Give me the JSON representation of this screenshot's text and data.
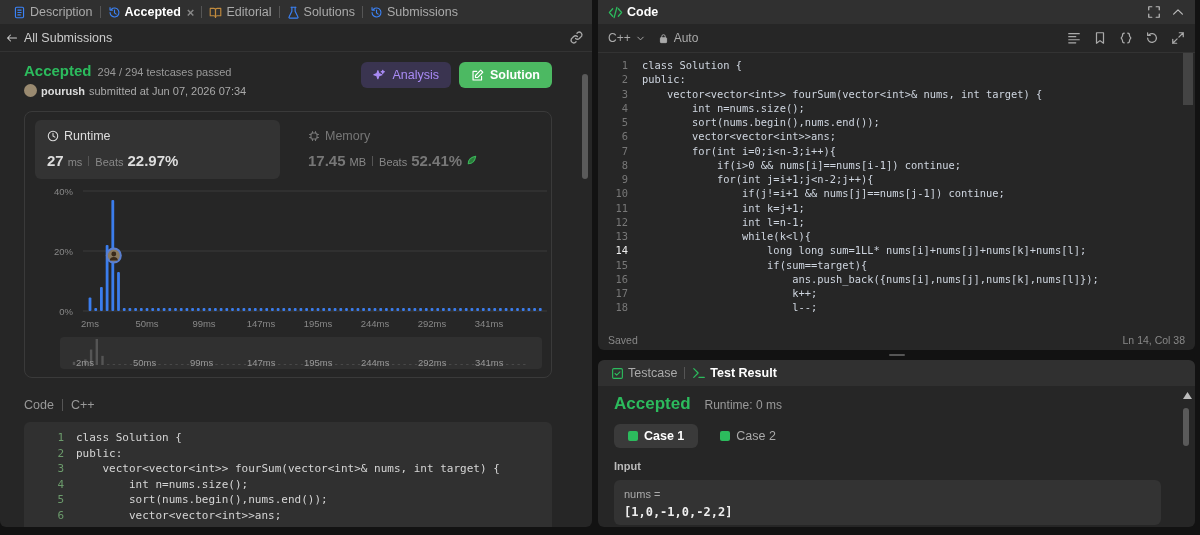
{
  "tabs": [
    {
      "label": "Description",
      "kind": "doc",
      "selected": false
    },
    {
      "label": "Accepted",
      "kind": "history",
      "selected": true,
      "close": "×"
    },
    {
      "label": "Editorial",
      "kind": "book",
      "selected": false
    },
    {
      "label": "Solutions",
      "kind": "flask",
      "selected": false
    },
    {
      "label": "Submissions",
      "kind": "history",
      "selected": false
    }
  ],
  "back_link": "All Submissions",
  "submission": {
    "status": "Accepted",
    "passed": "294 / 294 testcases passed",
    "user": "pourush",
    "submitted": "submitted at Jun 07, 2026 07:34",
    "buttons": [
      {
        "label": "Analysis",
        "kind": "analysis"
      },
      {
        "label": "Solution",
        "kind": "solution"
      }
    ]
  },
  "metrics": [
    {
      "kind": "runtime",
      "label": "Runtime",
      "value": "27",
      "unit": "ms",
      "beats_label": "Beats",
      "beats": "22.97%",
      "selected": true
    },
    {
      "kind": "memory",
      "label": "Memory",
      "value": "17.45",
      "unit": "MB",
      "beats_label": "Beats",
      "beats": "52.41%",
      "selected": false
    }
  ],
  "chart_data": {
    "type": "bar",
    "categories": [
      "2ms",
      null,
      null,
      null,
      null,
      null,
      null,
      null,
      null,
      null,
      "50ms",
      null,
      null,
      null,
      null,
      null,
      null,
      null,
      null,
      null,
      "99ms",
      null,
      null,
      null,
      null,
      null,
      null,
      null,
      null,
      null,
      "147ms",
      null,
      null,
      null,
      null,
      null,
      null,
      null,
      null,
      null,
      "195ms",
      null,
      null,
      null,
      null,
      null,
      null,
      null,
      null,
      null,
      "244ms",
      null,
      null,
      null,
      null,
      null,
      null,
      null,
      null,
      null,
      "292ms",
      null,
      null,
      null,
      null,
      null,
      null,
      null,
      null,
      null,
      "341ms",
      null,
      null,
      null,
      null,
      null,
      null,
      null,
      null,
      null
    ],
    "values": [
      4.5,
      1,
      8,
      22,
      37,
      13,
      1,
      1,
      1,
      1,
      1,
      1,
      1,
      1,
      1,
      1,
      1,
      1,
      1,
      1,
      1,
      1,
      1,
      1,
      1,
      1,
      1,
      1,
      1,
      1,
      1,
      1,
      1,
      1,
      1,
      1,
      1,
      1,
      1,
      1,
      1,
      1,
      1,
      1,
      1,
      1,
      1,
      1,
      1,
      1,
      1,
      1,
      1,
      1,
      1,
      1,
      1,
      1,
      1,
      1,
      1,
      1,
      1,
      1,
      1,
      1,
      1,
      1,
      1,
      1,
      1,
      1,
      1,
      1,
      1,
      1,
      1,
      1,
      1,
      1
    ],
    "ylim": [
      0,
      40
    ],
    "yticks": [
      {
        "value": 0,
        "label": "0%"
      },
      {
        "value": 20,
        "label": "20%"
      },
      {
        "value": 40,
        "label": "40%"
      }
    ]
  },
  "overview_labels": [
    "2ms",
    "50ms",
    "99ms",
    "147ms",
    "195ms",
    "244ms",
    "292ms",
    "341ms"
  ],
  "code_section": {
    "title": "Code",
    "language": "C++",
    "lines": [
      {
        "n": "1",
        "text": "class Solution {"
      },
      {
        "n": "2",
        "text": "public:"
      },
      {
        "n": "3",
        "text": "    vector<vector<int>> fourSum(vector<int>& nums, int target) {"
      },
      {
        "n": "4",
        "text": "        int n=nums.size();"
      },
      {
        "n": "5",
        "text": "        sort(nums.begin(),nums.end());"
      },
      {
        "n": "6",
        "text": "        vector<vector<int>>ans;"
      }
    ]
  },
  "editor": {
    "title": "Code",
    "language": "C++",
    "mode": "Auto",
    "lines": [
      {
        "n": "1",
        "text": "class Solution {",
        "active": false
      },
      {
        "n": "2",
        "text": "public:",
        "active": false
      },
      {
        "n": "3",
        "text": "    vector<vector<int>> fourSum(vector<int>& nums, int target) {",
        "active": false
      },
      {
        "n": "4",
        "text": "        int n=nums.size();",
        "active": false
      },
      {
        "n": "5",
        "text": "        sort(nums.begin(),nums.end());",
        "active": false
      },
      {
        "n": "6",
        "text": "        vector<vector<int>>ans;",
        "active": false
      },
      {
        "n": "7",
        "text": "        for(int i=0;i<n-3;i++){",
        "active": false
      },
      {
        "n": "8",
        "text": "            if(i>0 && nums[i]==nums[i-1]) continue;",
        "active": false
      },
      {
        "n": "9",
        "text": "            for(int j=i+1;j<n-2;j++){",
        "active": false
      },
      {
        "n": "10",
        "text": "                if(j!=i+1 && nums[j]==nums[j-1]) continue;",
        "active": false
      },
      {
        "n": "11",
        "text": "                int k=j+1;",
        "active": false
      },
      {
        "n": "12",
        "text": "                int l=n-1;",
        "active": false
      },
      {
        "n": "13",
        "text": "                while(k<l){",
        "active": false
      },
      {
        "n": "14",
        "text": "                    long long sum=1LL* nums[i]+nums[j]+nums[k]+nums[l];",
        "active": true
      },
      {
        "n": "15",
        "text": "                    if(sum==target){",
        "active": false
      },
      {
        "n": "16",
        "text": "                        ans.push_back({nums[i],nums[j],nums[k],nums[l]});",
        "active": false
      },
      {
        "n": "17",
        "text": "                        k++;",
        "active": false
      },
      {
        "n": "18",
        "text": "                        l--;",
        "active": false
      }
    ],
    "status": "Saved",
    "position": "Ln 14, Col 38"
  },
  "test_panel": {
    "tabs": [
      {
        "label": "Testcase",
        "kind": "check",
        "selected": false
      },
      {
        "label": "Test Result",
        "kind": "terminal",
        "selected": true
      }
    ],
    "status": "Accepted",
    "runtime": "Runtime: 0 ms",
    "cases": [
      {
        "label": "Case 1",
        "selected": true,
        "passed": true
      },
      {
        "label": "Case 2",
        "selected": false,
        "passed": true
      }
    ],
    "input_label": "Input",
    "var_name": "nums =",
    "var_value": "[1,0,-1,0,-2,2]"
  }
}
